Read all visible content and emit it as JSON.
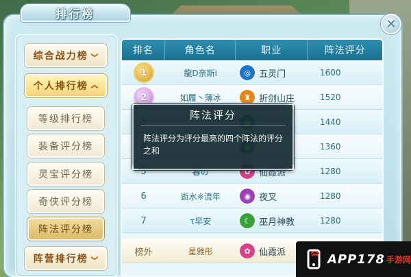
{
  "window": {
    "title": "排行榜",
    "close_glyph": "✕"
  },
  "menu": {
    "categories": [
      {
        "label": "综合战力榜",
        "chevron": "❯",
        "expanded": false
      },
      {
        "label": "个人排行榜",
        "chevron": "❯",
        "expanded": true
      },
      {
        "label": "阵营排行榜",
        "chevron": "❯",
        "expanded": false
      }
    ],
    "subitems": [
      {
        "label": "等级排行榜"
      },
      {
        "label": "装备评分榜"
      },
      {
        "label": "灵宝评分榜"
      },
      {
        "label": "奇侠评分榜"
      },
      {
        "label": "阵法评分榜",
        "selected": true
      }
    ]
  },
  "table": {
    "headers": [
      "排名",
      "角色名",
      "职业",
      "阵法评分"
    ],
    "rows": [
      {
        "rank": "1",
        "name": "龍D奈斯i",
        "job": "五灵门",
        "job_icon": "water-swirl-icon",
        "job_color": "#1f73c9",
        "score": "1600"
      },
      {
        "rank": "2",
        "name": "如履丶薄冰",
        "job": "折剑山庄",
        "job_icon": "sword-hilt-icon",
        "job_color": "#e0881f",
        "score": "1520"
      },
      {
        "rank": "3",
        "name": "",
        "job": "",
        "job_icon": "green-icon",
        "job_color": "#3fa64a",
        "score": "1440"
      },
      {
        "rank": "4",
        "name": "",
        "job": "",
        "job_icon": "green-icon",
        "job_color": "#3fa64a",
        "score": "1360"
      },
      {
        "rank": "5",
        "name": "暮の",
        "job": "仙霞派",
        "job_icon": "pink-lotus-icon",
        "job_color": "#d8418a",
        "score": "1280"
      },
      {
        "rank": "6",
        "name": "逝水※流年",
        "job": "夜叉",
        "job_icon": "purple-orb-icon",
        "job_color": "#9a3fb8",
        "score": "1280"
      },
      {
        "rank": "7",
        "name": "τ早安",
        "job": "巫月神教",
        "job_icon": "green-moon-icon",
        "job_color": "#3aa23c",
        "score": "1280"
      }
    ],
    "self_row": {
      "rank": "榜外",
      "name": "星雅彤",
      "job": "仙霞派",
      "job_icon": "pink-lotus-icon",
      "job_color": "#d8418a",
      "score": "1280"
    }
  },
  "tooltip": {
    "title": "阵法评分",
    "body": "阵法评分为评分最高的四个阵法的评分之和"
  },
  "watermark": {
    "text": "APP178",
    "sub": "手游网"
  }
}
